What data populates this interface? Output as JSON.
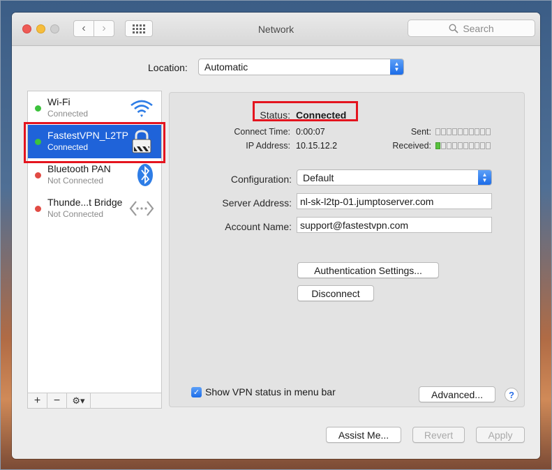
{
  "window": {
    "title": "Network",
    "search_placeholder": "Search"
  },
  "location": {
    "label": "Location:",
    "value": "Automatic"
  },
  "services": [
    {
      "name": "Wi-Fi",
      "status": "Connected",
      "status_color": "#3cc23c",
      "icon": "wifi-icon"
    },
    {
      "name": "FastestVPN_L2TP",
      "status": "Connected",
      "status_color": "#3cc23c",
      "icon": "lock-icon",
      "selected": true
    },
    {
      "name": "Bluetooth PAN",
      "status": "Not Connected",
      "status_color": "#e14b44",
      "icon": "bluetooth-icon"
    },
    {
      "name": "Thunde...t Bridge",
      "status": "Not Connected",
      "status_color": "#e14b44",
      "icon": "thunderbolt-bridge-icon"
    }
  ],
  "sidebar_tools": {
    "add": "+",
    "remove": "−",
    "gear": "⚙▾"
  },
  "detail": {
    "status_label": "Status:",
    "status_value": "Connected",
    "connect_time_label": "Connect Time:",
    "connect_time_value": "0:00:07",
    "ip_label": "IP Address:",
    "ip_value": "10.15.12.2",
    "sent_label": "Sent:",
    "received_label": "Received:",
    "configuration_label": "Configuration:",
    "configuration_value": "Default",
    "server_label": "Server Address:",
    "server_value": "nl-sk-l2tp-01.jumptoserver.com",
    "account_label": "Account Name:",
    "account_value": "support@fastestvpn.com",
    "auth_button": "Authentication Settings...",
    "disconnect_button": "Disconnect",
    "show_vpn_label": "Show VPN status in menu bar",
    "show_vpn_checked": true,
    "advanced_button": "Advanced...",
    "help": "?"
  },
  "footer": {
    "assist": "Assist Me...",
    "revert": "Revert",
    "apply": "Apply"
  },
  "colors": {
    "selection": "#1f63d9",
    "highlight_box": "#e4141e",
    "connected": "#3cc23c",
    "not_connected": "#e14b44"
  }
}
